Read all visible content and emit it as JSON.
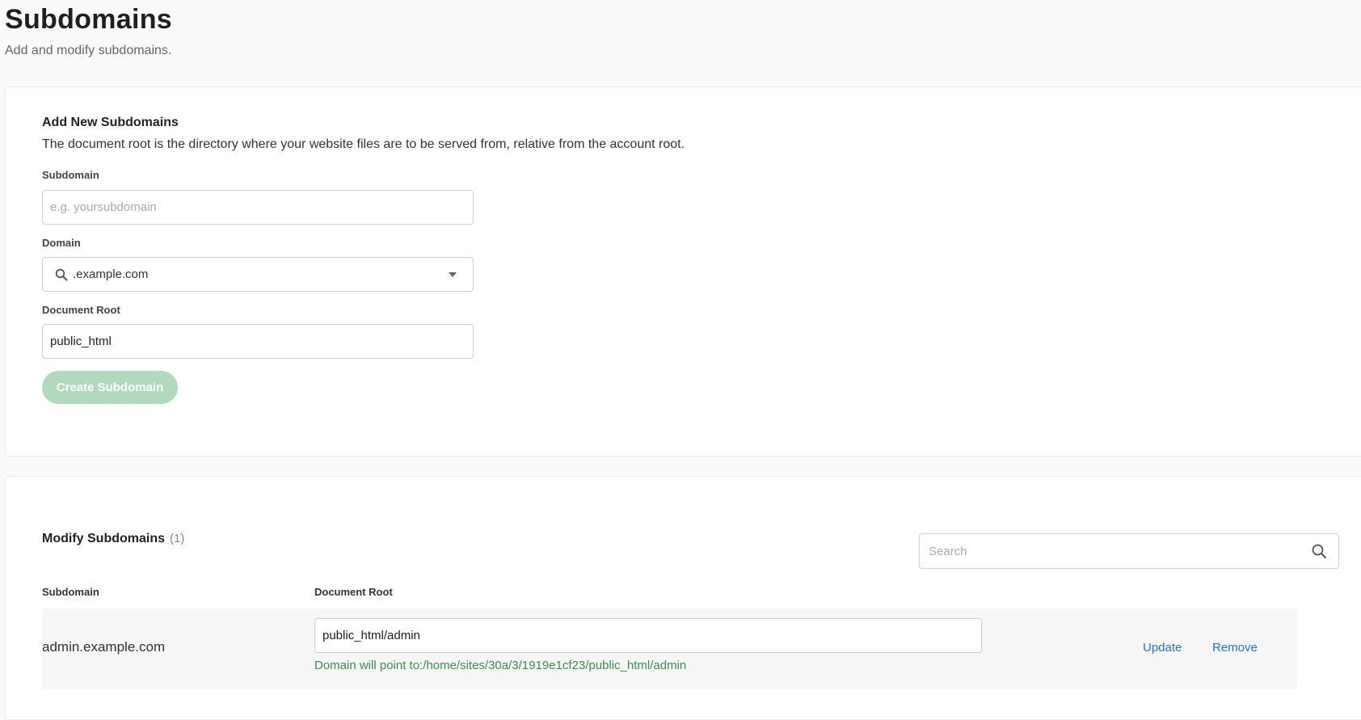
{
  "header": {
    "title": "Subdomains",
    "subtitle": "Add and modify subdomains."
  },
  "add_section": {
    "title": "Add New Subdomains",
    "description": "The document root is the directory where your website files are to be served from, relative from the account root.",
    "subdomain_label": "Subdomain",
    "subdomain_placeholder": "e.g. yoursubdomain",
    "subdomain_value": "",
    "domain_label": "Domain",
    "domain_selected": ".example.com",
    "docroot_label": "Document Root",
    "docroot_value": "public_html",
    "create_button": "Create Subdomain"
  },
  "modify_section": {
    "title": "Modify Subdomains",
    "count": "(1)",
    "search_placeholder": "Search",
    "columns": {
      "subdomain": "Subdomain",
      "document_root": "Document Root"
    },
    "rows": [
      {
        "subdomain": "admin.example.com",
        "document_root": "public_html/admin",
        "hint": "Domain will point to:/home/sites/30a/3/1919e1cf23/public_html/admin",
        "update_label": "Update",
        "remove_label": "Remove"
      }
    ]
  },
  "colors": {
    "accent_link": "#2b6fd1",
    "button_disabled": "#b2d8be",
    "hint_green": "#3e8e4f"
  }
}
